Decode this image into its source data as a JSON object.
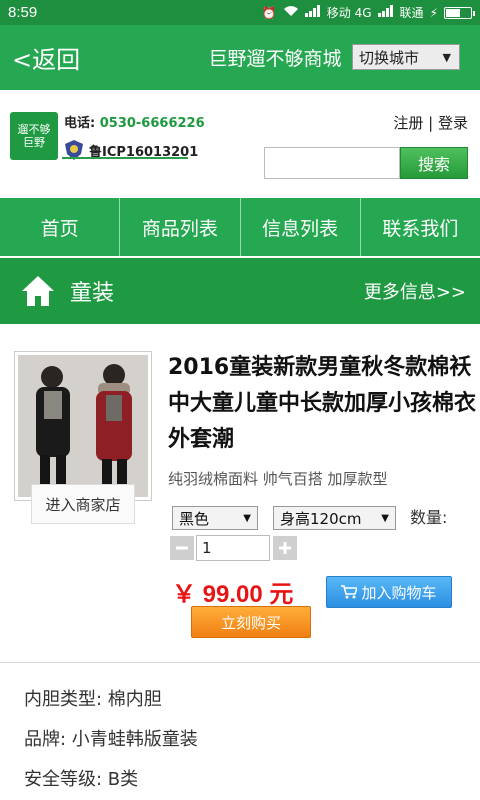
{
  "status_bar": {
    "time": "8:59",
    "carrier1": "移动 4G",
    "carrier2": "联通",
    "battery_level": 0.55
  },
  "topbar": {
    "back_label": "<返回",
    "title": "巨野遛不够商城",
    "city_select": "切换城市"
  },
  "header": {
    "logo_line1": "遛不够",
    "logo_line2": "巨野",
    "phone_label": "电话:",
    "phone": "0530-6666226",
    "icp": "鲁ICP16013201",
    "register": "注册",
    "separator": "|",
    "login": "登录",
    "search_placeholder": "",
    "search_button": "搜索"
  },
  "nav": [
    "首页",
    "商品列表",
    "信息列表",
    "联系我们"
  ],
  "section": {
    "title": "童装",
    "more": "更多信息>>"
  },
  "product": {
    "title": "2016童装新款男童秋冬款棉袄中大童儿童中长款加厚小孩棉衣外套潮",
    "subtitle": "纯羽绒棉面料 帅气百搭 加厚款型",
    "color_option": "黑色",
    "size_option": "身高120cm",
    "qty_label": "数量:",
    "qty_value": "1",
    "price": "￥ 99.00 元",
    "add_to_cart": "加入购物车",
    "buy_now": "立刻购买",
    "enter_shop": "进入商家店"
  },
  "attributes": [
    "内胆类型: 棉内胆",
    "品牌: 小青蛙韩版童装",
    "安全等级: B类"
  ],
  "colors": {
    "primary_green": "#26a852",
    "status_green": "#1e8f3e",
    "price_red": "#e81414",
    "cart_blue": "#2b8fe3",
    "buy_orange": "#f07f12"
  }
}
